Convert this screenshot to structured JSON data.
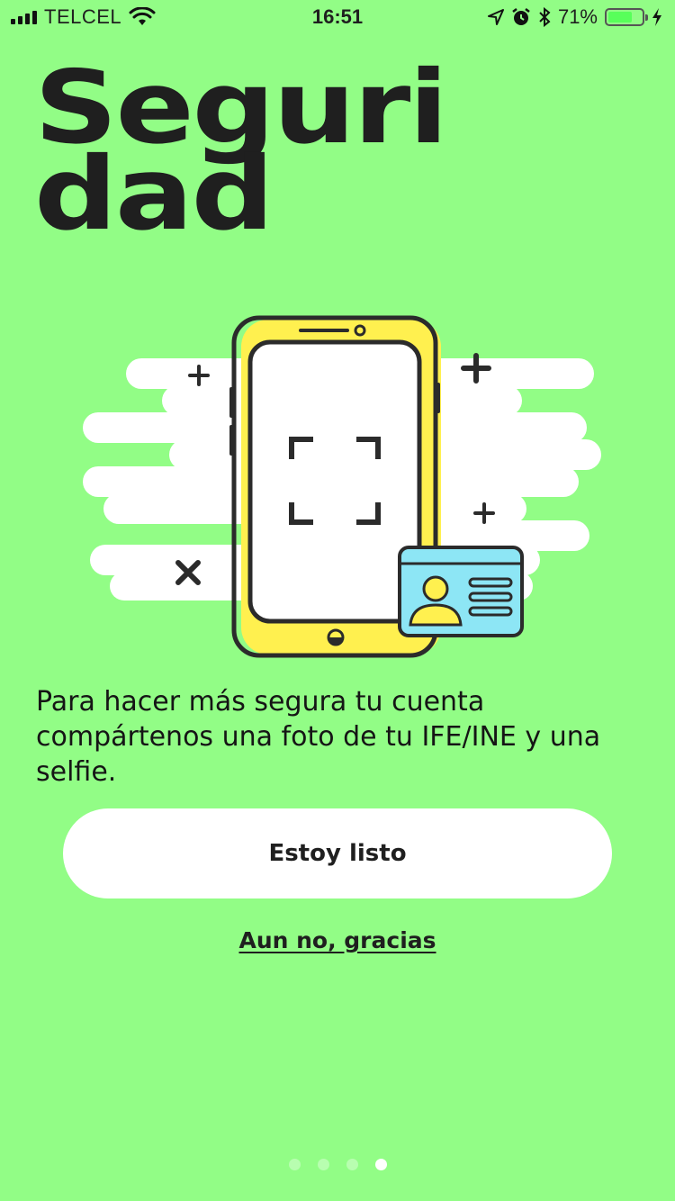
{
  "status_bar": {
    "carrier": "TELCEL",
    "time": "16:51",
    "battery_percent": "71%",
    "battery_level": 0.71,
    "icons": [
      "signal-icon",
      "wifi-icon",
      "location-icon",
      "alarm-icon",
      "bluetooth-icon",
      "battery-icon",
      "charging-icon"
    ]
  },
  "title": {
    "line1": "Seguri",
    "line2": "dad"
  },
  "illustration": {
    "icons": [
      "phone-icon",
      "scan-frame-icon",
      "id-card-icon",
      "plus-icon",
      "x-icon"
    ],
    "colors": {
      "phone_body": "#fff04f",
      "outline": "#2b2b2b",
      "card": "#8de6f5",
      "clouds": "#ffffff"
    }
  },
  "description": "Para hacer más segura tu cuenta compártenos una foto de tu IFE/INE y una selfie.",
  "actions": {
    "primary_label": "Estoy listo",
    "secondary_label": "Aun no, gracias"
  },
  "pager": {
    "count": 4,
    "active_index": 3
  },
  "colors": {
    "background": "#92fd86",
    "button": "#ffffff",
    "text": "#1f1f1f"
  }
}
